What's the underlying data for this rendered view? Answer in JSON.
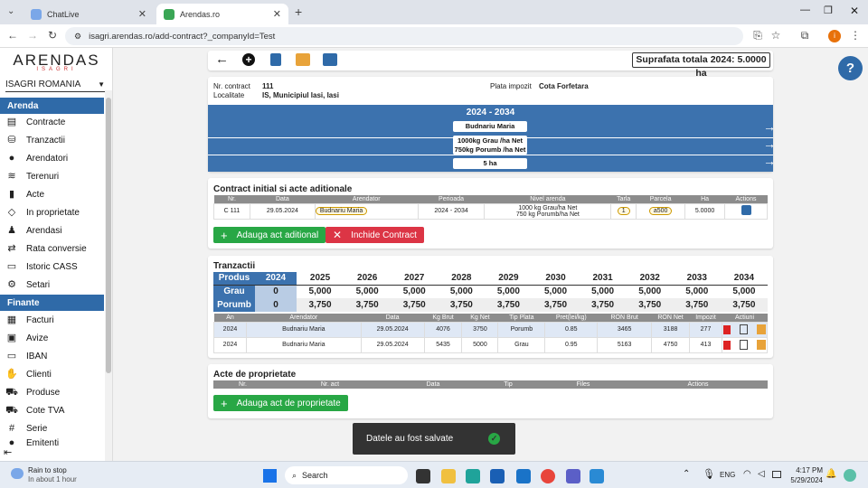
{
  "browser": {
    "tabs": [
      {
        "title": "ChatLive",
        "active": false
      },
      {
        "title": "Arendas.ro",
        "active": true
      }
    ],
    "url": "isagri.arendas.ro/add-contract?_companyId=Test"
  },
  "sidebar": {
    "logo": "ARENDAS",
    "logo_sub": "ISAGRI",
    "company": "ISAGRI ROMANIA",
    "sections": [
      {
        "title": "Arenda",
        "items": [
          "Contracte",
          "Tranzactii",
          "Arendatori",
          "Terenuri",
          "Acte",
          "In proprietate",
          "Arendasi",
          "Rata conversie",
          "Istoric CASS",
          "Setari"
        ]
      },
      {
        "title": "Finante",
        "items": [
          "Facturi",
          "Avize",
          "IBAN",
          "Clienti",
          "Produse",
          "Cote TVA",
          "Serie",
          "Emitenti"
        ]
      }
    ]
  },
  "toolbar": {
    "surface_label": "Suprafata totala 2024: 5.0000 ha"
  },
  "contract": {
    "nr_label": "Nr. contract",
    "nr_value": "111",
    "loc_label": "Localitate",
    "loc_value": "IS, Municipiul Iasi, Iasi",
    "plata_label": "Plata impozit",
    "plata_value": "Cota Forfetara"
  },
  "band": {
    "period": "2024 - 2034",
    "owner": "Budnariu Maria",
    "rent_line1": "1000kg Grau /ha Net",
    "rent_line2": "750kg Porumb /ha Net",
    "area": "5 ha"
  },
  "contract_section": {
    "title": "Contract initial si acte aditionale",
    "headers": [
      "Nr.",
      "Data",
      "Arendator",
      "Perioada",
      "Nivel arenda",
      "Tarla",
      "Parcela",
      "Ha",
      "Actions"
    ],
    "row": {
      "nr": "C 111",
      "data": "29.05.2024",
      "arendator": "Budnariu Maria",
      "perioada": "2024 - 2034",
      "nivel1": "1000 kg Grau/ha Net",
      "nivel2": "750 kg Porumb/ha Net",
      "tarla": "1",
      "parcela": "a500",
      "ha": "5.0000"
    },
    "add_btn": "Adauga act aditional",
    "close_btn": "Inchide Contract"
  },
  "tranzactii": {
    "title": "Tranzactii",
    "produs_label": "Produs",
    "years": [
      "2024",
      "2025",
      "2026",
      "2027",
      "2028",
      "2029",
      "2030",
      "2031",
      "2032",
      "2033",
      "2034"
    ],
    "products": [
      {
        "name": "Grau",
        "values": [
          "0",
          "5,000",
          "5,000",
          "5,000",
          "5,000",
          "5,000",
          "5,000",
          "5,000",
          "5,000",
          "5,000",
          "5,000"
        ]
      },
      {
        "name": "Porumb",
        "values": [
          "0",
          "3,750",
          "3,750",
          "3,750",
          "3,750",
          "3,750",
          "3,750",
          "3,750",
          "3,750",
          "3,750",
          "3,750"
        ]
      }
    ],
    "headers": [
      "An",
      "Arendator",
      "Data",
      "Kg Brut",
      "Kg Net",
      "Tip Plata",
      "Pret(lei/kg)",
      "RON Brut",
      "RON Net",
      "Impozit",
      "Actiuni"
    ],
    "rows": [
      [
        "2024",
        "Budnariu Maria",
        "29.05.2024",
        "4076",
        "3750",
        "Porumb",
        "0.85",
        "3465",
        "3188",
        "277"
      ],
      [
        "2024",
        "Budnariu Maria",
        "29.05.2024",
        "5435",
        "5000",
        "Grau",
        "0.95",
        "5163",
        "4750",
        "413"
      ]
    ]
  },
  "acte": {
    "title": "Acte de proprietate",
    "headers": [
      "Nr.",
      "Nr. act",
      "Data",
      "Tip",
      "Files",
      "Actions"
    ],
    "add_btn": "Adauga act de proprietate"
  },
  "toast": "Datele au fost salvate",
  "taskbar": {
    "weather_title": "Rain to stop",
    "weather_sub": "In about 1 hour",
    "search": "Search",
    "lang": "ENG",
    "time": "4:17 PM",
    "date": "5/29/2024"
  }
}
